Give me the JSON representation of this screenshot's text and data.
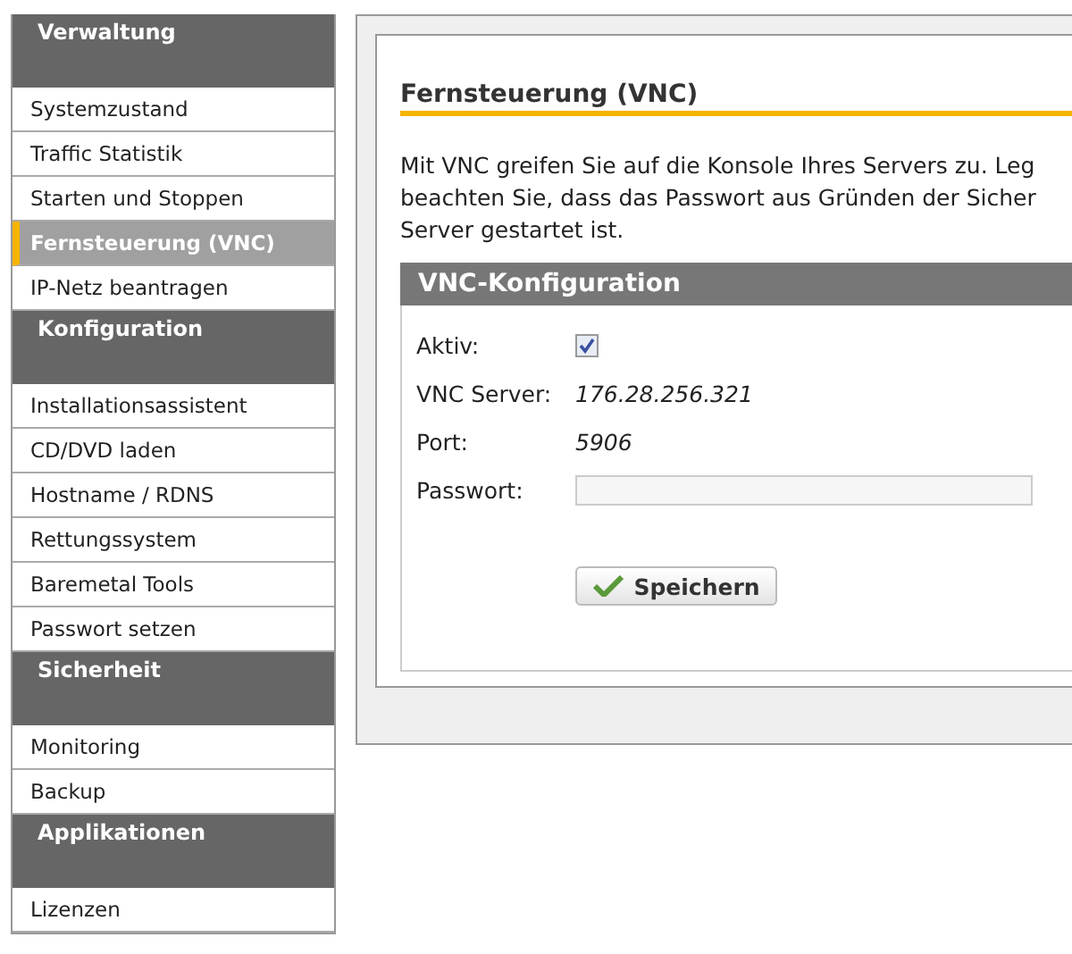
{
  "sidebar": {
    "groups": [
      {
        "title": "Verwaltung",
        "items": [
          {
            "label": "Systemzustand",
            "selected": false
          },
          {
            "label": "Traffic Statistik",
            "selected": false
          },
          {
            "label": "Starten und Stoppen",
            "selected": false
          },
          {
            "label": "Fernsteuerung (VNC)",
            "selected": true
          },
          {
            "label": "IP-Netz beantragen",
            "selected": false
          }
        ]
      },
      {
        "title": "Konfiguration",
        "items": [
          {
            "label": "Installationsassistent",
            "selected": false
          },
          {
            "label": "CD/DVD laden",
            "selected": false
          },
          {
            "label": "Hostname / RDNS",
            "selected": false
          },
          {
            "label": "Rettungssystem",
            "selected": false
          },
          {
            "label": "Baremetal Tools",
            "selected": false
          },
          {
            "label": "Passwort setzen",
            "selected": false
          }
        ]
      },
      {
        "title": "Sicherheit",
        "items": [
          {
            "label": "Monitoring",
            "selected": false
          },
          {
            "label": "Backup",
            "selected": false
          }
        ]
      },
      {
        "title": "Applikationen",
        "items": [
          {
            "label": "Lizenzen",
            "selected": false
          }
        ]
      }
    ]
  },
  "main": {
    "title": "Fernsteuerung (VNC)",
    "intro_lines": [
      "Mit VNC greifen Sie auf die Konsole Ihres Servers zu. Leg",
      "beachten Sie, dass das Passwort aus Gründen der Sicher",
      "Server gestartet ist."
    ],
    "config": {
      "title": "VNC-Konfiguration",
      "fields": [
        {
          "kind": "checkbox",
          "label": "Aktiv:",
          "checked": true
        },
        {
          "kind": "value",
          "label": "VNC Server:",
          "value": "176.28.256.321"
        },
        {
          "kind": "value",
          "label": "Port:",
          "value": "5906"
        },
        {
          "kind": "input",
          "label": "Passwort:"
        }
      ],
      "save_button": "Speichern"
    }
  }
}
